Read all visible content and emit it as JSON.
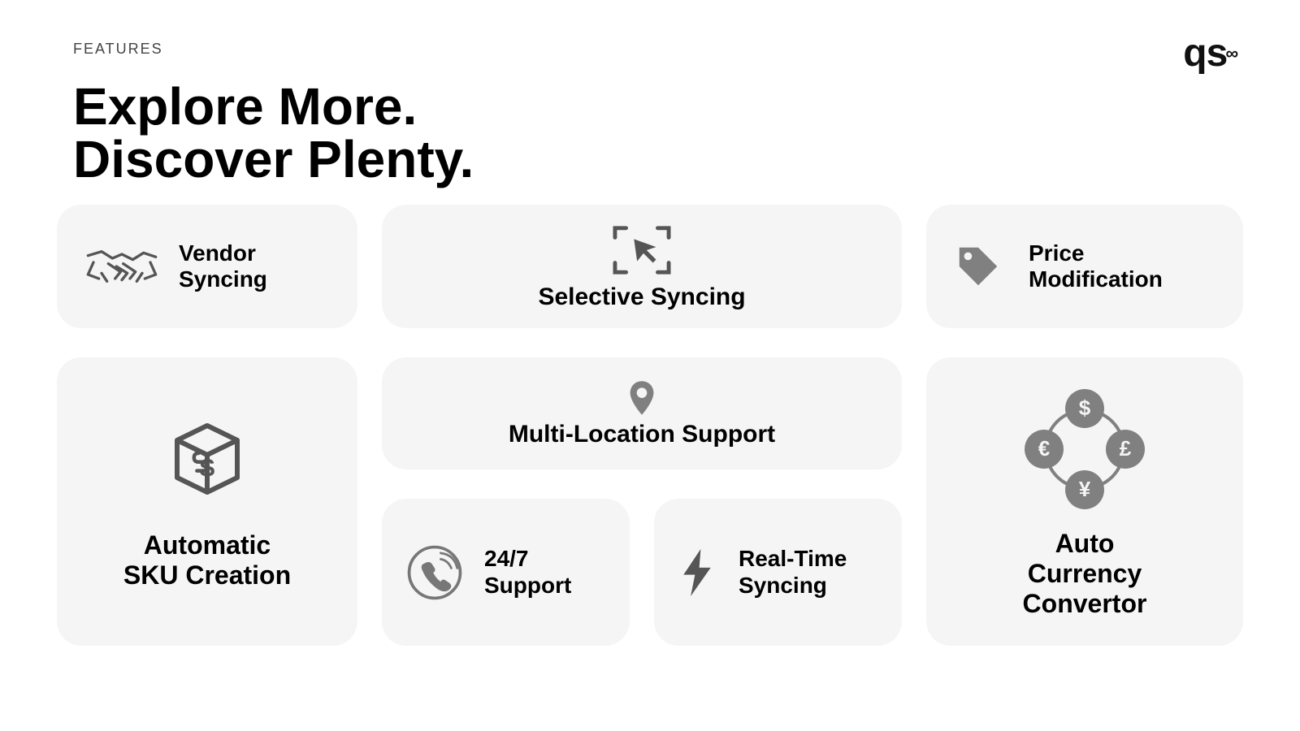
{
  "header": {
    "eyebrow": "FEATURES",
    "headline_line1": "Explore More.",
    "headline_line2": "Discover Plenty.",
    "logo_text": "qs"
  },
  "cards": {
    "vendor": {
      "line1": "Vendor",
      "line2": "Syncing",
      "icon": "handshake-icon"
    },
    "selective": {
      "title": "Selective Syncing",
      "icon": "cursor-focus-icon"
    },
    "price": {
      "line1": "Price",
      "line2": "Modification",
      "icon": "price-tag-icon"
    },
    "sku": {
      "line1": "Automatic",
      "line2": "SKU Creation",
      "icon": "sku-box-icon"
    },
    "multiloc": {
      "title": "Multi-Location Support",
      "icon": "map-pin-icon"
    },
    "support": {
      "line1": "24/7",
      "line2": "Support",
      "icon": "phone-ring-icon"
    },
    "realtime": {
      "line1": "Real-Time",
      "line2": "Syncing",
      "icon": "lightning-icon"
    },
    "currency": {
      "line1": "Auto",
      "line2": "Currency",
      "line3": "Convertor",
      "icon": "currency-cycle-icon"
    }
  }
}
